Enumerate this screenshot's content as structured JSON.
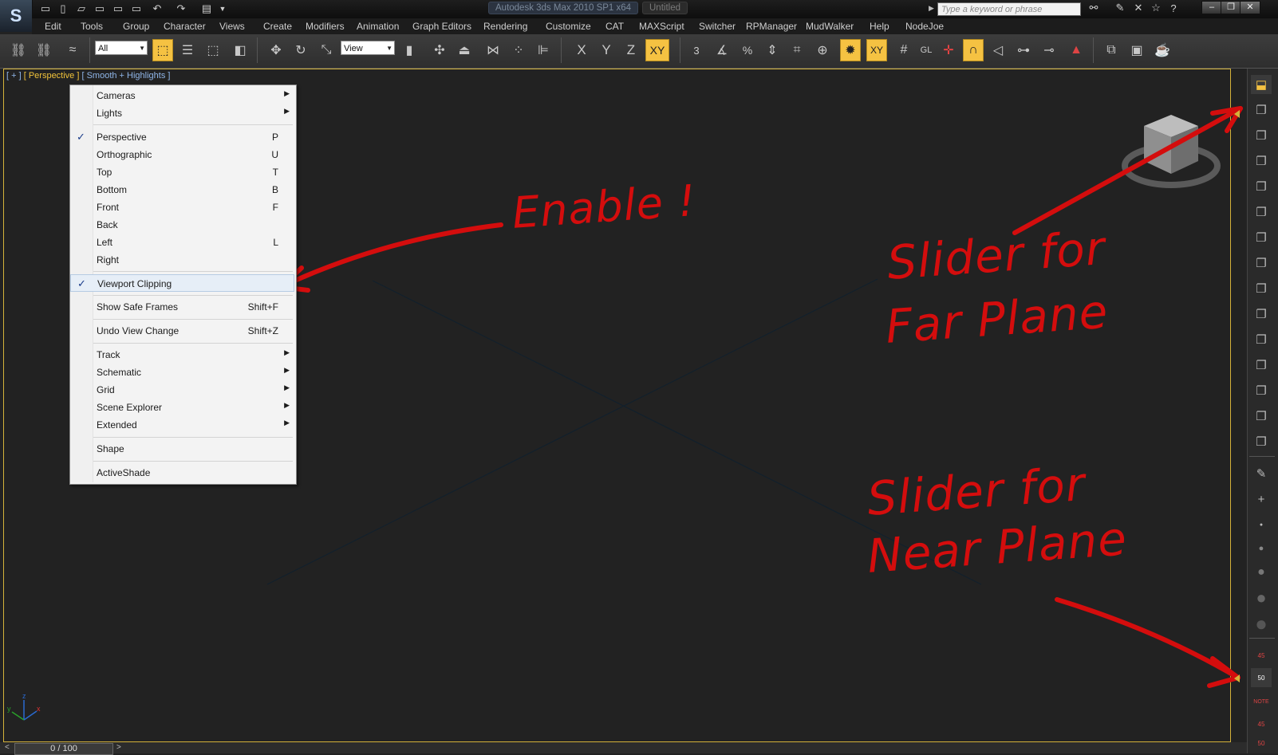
{
  "title_bar": {
    "app_title": "Autodesk 3ds Max  2010 SP1 x64",
    "file_title": "Untitled",
    "search_placeholder": "Type a keyword or phrase"
  },
  "menu": [
    "Edit",
    "Tools",
    "Group",
    "Character",
    "Views",
    "Create",
    "Modifiers",
    "Animation",
    "Graph Editors",
    "Rendering",
    "Customize",
    "CAT",
    "MAXScript",
    "Switcher",
    "RPManager",
    "MudWalker",
    "Help",
    "NodeJoe"
  ],
  "toolbar": {
    "selection_filter": "All",
    "reference_coord": "View",
    "axis_x": "X",
    "axis_y": "Y",
    "axis_z": "Z",
    "axis_xy": "XY",
    "axis_xy_small": "XY",
    "snap_3": "3",
    "snap_gl": "GL"
  },
  "viewport": {
    "label_plus": "[ + ]",
    "label_view": "[ Perspective ]",
    "label_shading": "[ Smooth + Highlights ]",
    "axis_x": "x",
    "axis_y": "y",
    "axis_z": "z"
  },
  "context_menu": {
    "cameras": "Cameras",
    "lights": "Lights",
    "perspective": "Perspective",
    "perspective_sc": "P",
    "orthographic": "Orthographic",
    "orthographic_sc": "U",
    "top": "Top",
    "top_sc": "T",
    "bottom": "Bottom",
    "bottom_sc": "B",
    "front": "Front",
    "front_sc": "F",
    "back": "Back",
    "left": "Left",
    "left_sc": "L",
    "right": "Right",
    "viewport_clipping": "Viewport Clipping",
    "show_safe_frames": "Show Safe Frames",
    "show_safe_frames_sc": "Shift+F",
    "undo_view_change": "Undo View Change",
    "undo_view_change_sc": "Shift+Z",
    "track": "Track",
    "schematic": "Schematic",
    "grid": "Grid",
    "scene_explorer": "Scene Explorer",
    "extended": "Extended",
    "shape": "Shape",
    "activeshade": "ActiveShade"
  },
  "annotations": {
    "enable": "Enable !",
    "far_line1": "Slider for",
    "far_line2": "Far Plane",
    "near_line1": "Slider for",
    "near_line2": "Near Plane"
  },
  "right_panel": {
    "badge_45a": "45",
    "badge_50": "50",
    "badge_note": "NOTE",
    "badge_45b": "45",
    "badge_50b": "50"
  },
  "timeline": {
    "frame": "0 / 100",
    "prev": "<",
    "next": ">"
  },
  "colors": {
    "annotation": "#d40d0d",
    "viewport_border": "#d4b23a",
    "highlight_button": "#f5c242"
  }
}
